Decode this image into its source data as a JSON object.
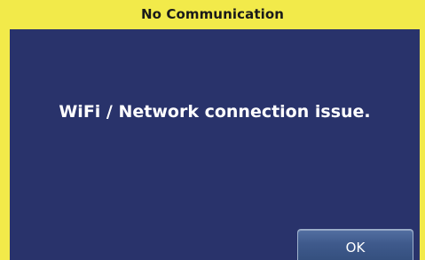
{
  "dialog": {
    "title": "No Communication",
    "message": "WiFi / Network connection issue.",
    "ok_label": "OK"
  },
  "colors": {
    "frame": "#f2ea4a",
    "content_background": "#29336b",
    "button": "#3f5a8c",
    "text": "#ffffff"
  }
}
